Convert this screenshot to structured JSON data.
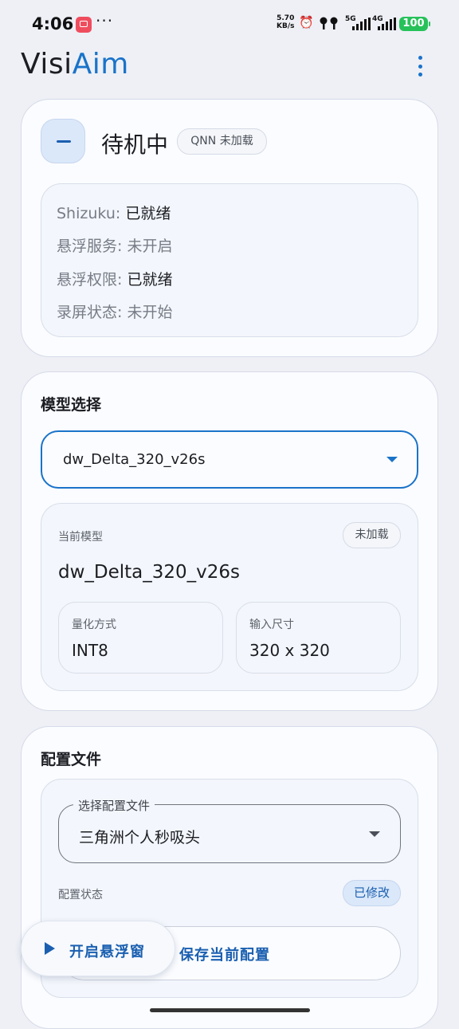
{
  "status_bar": {
    "time": "4:06",
    "more": "···",
    "net_speed_value": "5.70",
    "net_speed_unit": "KB/s",
    "net_5g": "5G",
    "net_4g": "4G",
    "battery": "100"
  },
  "app": {
    "title_part1": "Visi",
    "title_part2": "Aim",
    "brand_color": "#1a73c9"
  },
  "status_card": {
    "title": "待机中",
    "chip": "QNN 未加载",
    "lines": [
      {
        "label": "Shizuku: ",
        "value": "已就绪"
      },
      {
        "label": "悬浮服务: ",
        "value": "未开启"
      },
      {
        "label": "悬浮权限: ",
        "value": "已就绪"
      },
      {
        "label": "录屏状态: ",
        "value": "未开始"
      }
    ]
  },
  "model_card": {
    "section_title": "模型选择",
    "selected_model": "dw_Delta_320_v26s",
    "current_label": "当前模型",
    "current_chip": "未加载",
    "current_model": "dw_Delta_320_v26s",
    "quant_label": "量化方式",
    "quant_value": "INT8",
    "input_label": "输入尺寸",
    "input_value": "320 x 320"
  },
  "config_card": {
    "section_title": "配置文件",
    "field_label": "选择配置文件",
    "field_value": "三角洲个人秒吸头",
    "status_label": "配置状态",
    "status_chip": "已修改",
    "save_button": "保存当前配置"
  },
  "fab": {
    "label": "开启悬浮窗"
  }
}
